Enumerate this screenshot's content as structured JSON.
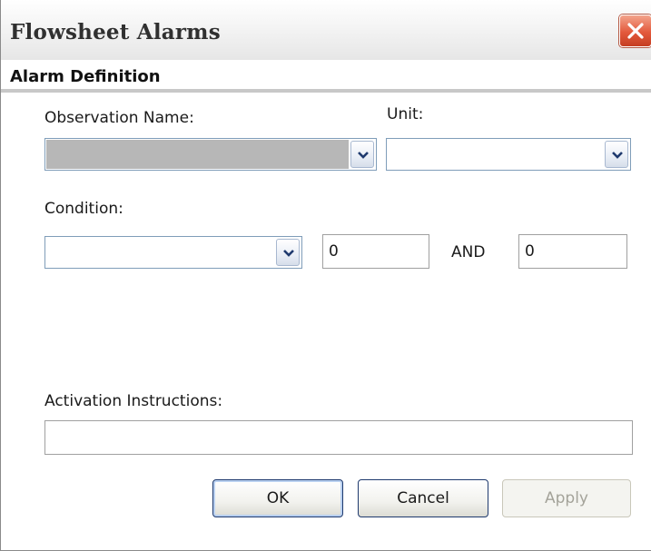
{
  "window": {
    "title": "Flowsheet Alarms"
  },
  "section": {
    "title": "Alarm Definition"
  },
  "form": {
    "observation_label": "Observation Name:",
    "observation_value": "",
    "unit_label": "Unit:",
    "unit_value": "",
    "condition_label": "Condition:",
    "condition_value": "",
    "lower_value": "0",
    "and_label": "AND",
    "upper_value": "0",
    "activation_label": "Activation Instructions:",
    "activation_value": ""
  },
  "buttons": {
    "ok": "OK",
    "cancel": "Cancel",
    "apply": "Apply"
  },
  "colors": {
    "close_button": "#e3593c",
    "field_border": "#7f9db9",
    "disabled_fill": "#b7b7b7"
  }
}
